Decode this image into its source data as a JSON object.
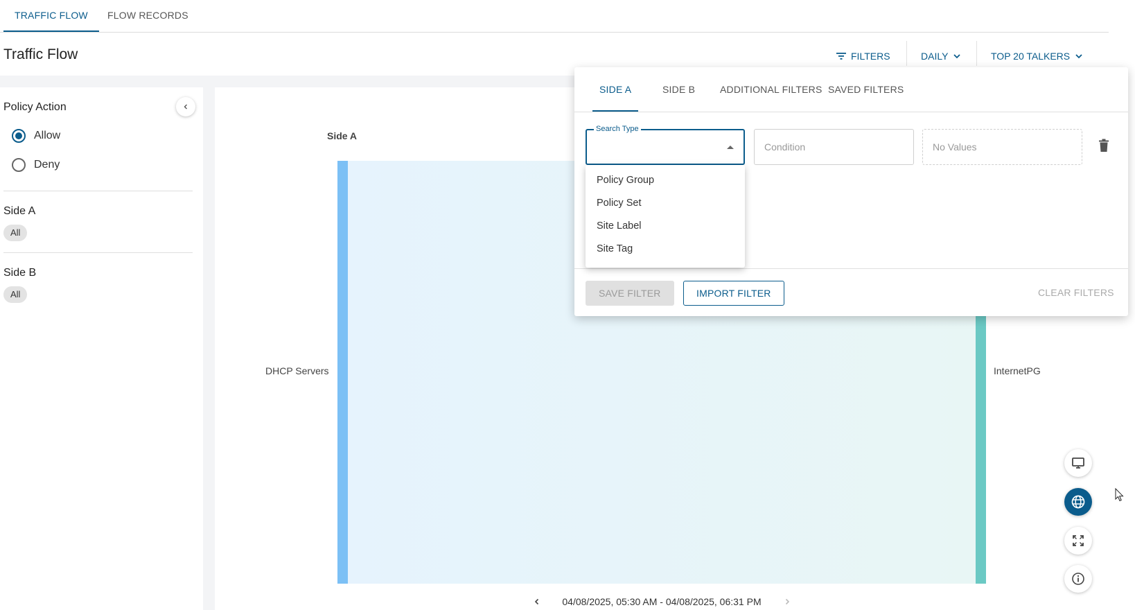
{
  "top_tabs": [
    {
      "label": "TRAFFIC FLOW",
      "active": true
    },
    {
      "label": "FLOW RECORDS",
      "active": false
    }
  ],
  "header": {
    "title": "Traffic Flow",
    "filters_label": "FILTERS",
    "period_label": "DAILY",
    "talkers_label": "TOP 20 TALKERS"
  },
  "left_panel": {
    "policy_action_heading": "Policy Action",
    "options": [
      {
        "label": "Allow",
        "checked": true
      },
      {
        "label": "Deny",
        "checked": false
      }
    ],
    "side_a_heading": "Side A",
    "side_a_chip": "All",
    "side_b_heading": "Side B",
    "side_b_chip": "All"
  },
  "chart": {
    "side_a_label": "Side A",
    "left_node": "DHCP Servers",
    "right_node": "InternetPG",
    "date_range": "04/08/2025, 05:30 AM - 04/08/2025, 06:31 PM",
    "left_color": "#7cc0f5",
    "right_color": "#6bc9c4"
  },
  "popover": {
    "tabs": [
      {
        "label": "SIDE A",
        "active": true
      },
      {
        "label": "SIDE B",
        "active": false
      },
      {
        "label": "ADDITIONAL FILTERS",
        "active": false
      },
      {
        "label": "SAVED FILTERS",
        "active": false
      }
    ],
    "search_type_label": "Search Type",
    "condition_placeholder": "Condition",
    "values_placeholder": "No Values",
    "save_filter": "SAVE FILTER",
    "import_filter": "IMPORT FILTER",
    "clear_filters": "CLEAR FILTERS"
  },
  "dropdown": {
    "options": [
      "Policy Group",
      "Policy Set",
      "Site Label",
      "Site Tag"
    ]
  },
  "colors": {
    "accent": "#0b5c8c"
  }
}
